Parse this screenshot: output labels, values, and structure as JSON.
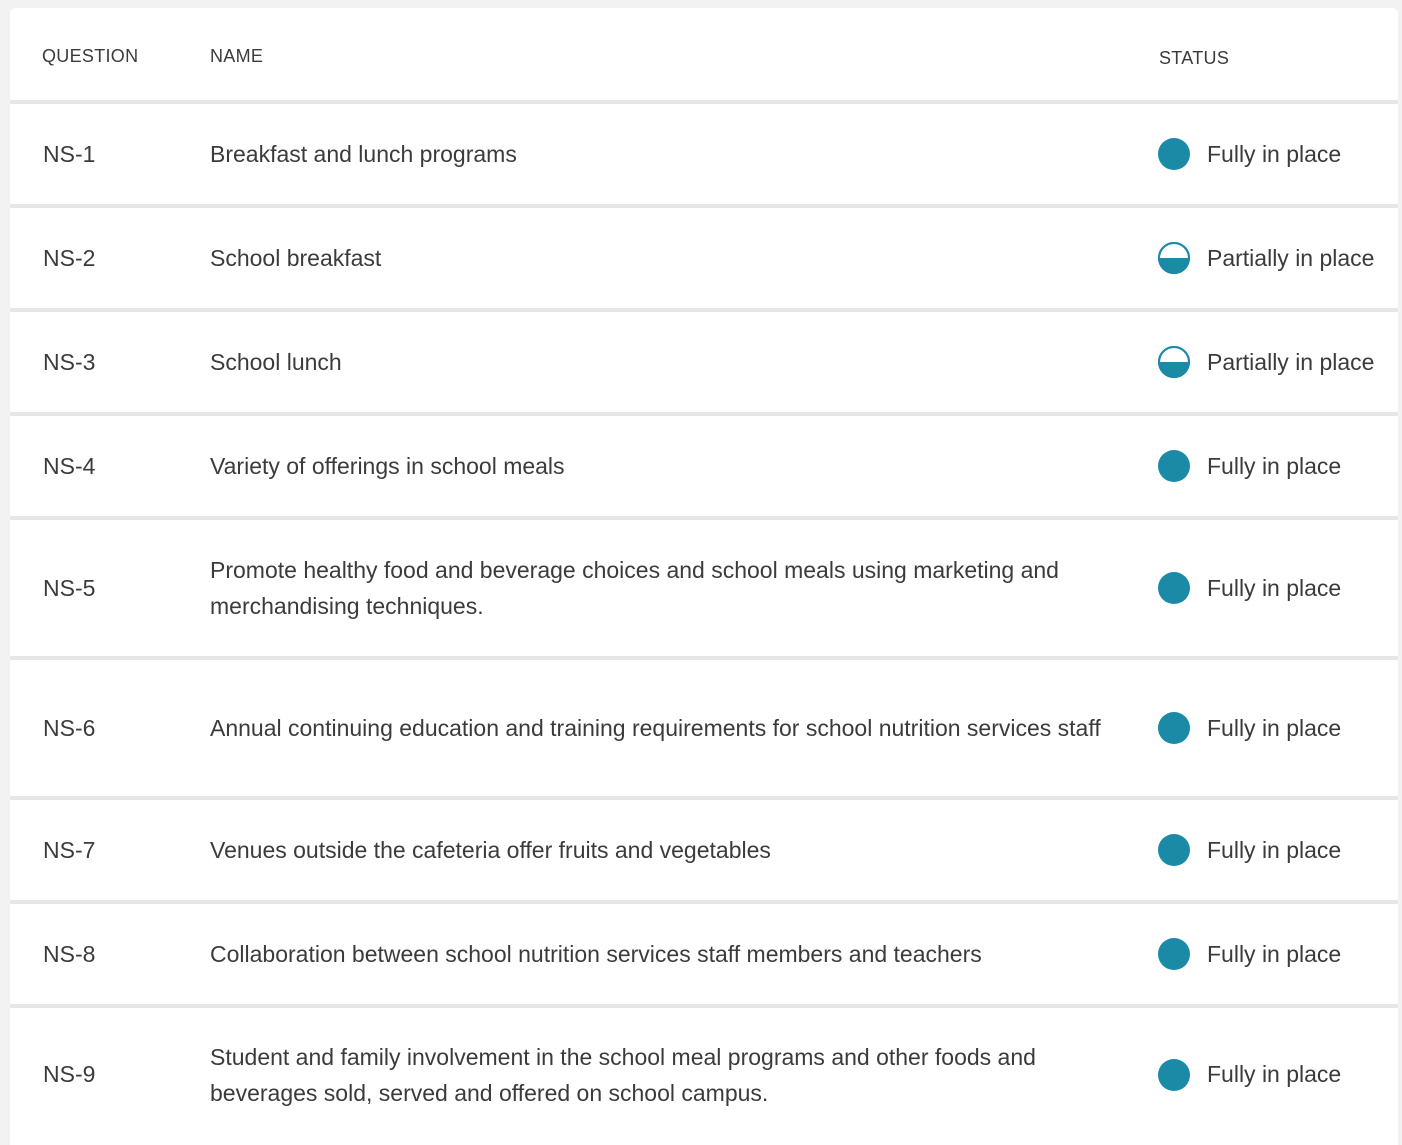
{
  "colors": {
    "accent": "#1b8aa6",
    "divider": "#e6e6e6",
    "text": "#3b3b3b"
  },
  "table": {
    "headers": {
      "question": "QUESTION",
      "name": "NAME",
      "status": "STATUS"
    },
    "rows": [
      {
        "question": "NS-1",
        "name": "Breakfast and lunch programs",
        "status": "Fully in place",
        "status_icon": "full-circle-icon"
      },
      {
        "question": "NS-2",
        "name": "School breakfast",
        "status": "Partially in place",
        "status_icon": "half-circle-icon"
      },
      {
        "question": "NS-3",
        "name": "School lunch",
        "status": "Partially in place",
        "status_icon": "half-circle-icon"
      },
      {
        "question": "NS-4",
        "name": "Variety of offerings in school meals",
        "status": "Fully in place",
        "status_icon": "full-circle-icon"
      },
      {
        "question": "NS-5",
        "name": "Promote healthy food and beverage choices and school meals using marketing and merchandising techniques.",
        "status": "Fully in place",
        "status_icon": "full-circle-icon"
      },
      {
        "question": "NS-6",
        "name": "Annual continuing education and training requirements for school nutrition services staff",
        "status": "Fully in place",
        "status_icon": "full-circle-icon"
      },
      {
        "question": "NS-7",
        "name": "Venues outside the cafeteria offer fruits and vegetables",
        "status": "Fully in place",
        "status_icon": "full-circle-icon"
      },
      {
        "question": "NS-8",
        "name": "Collaboration between school nutrition services staff members and teachers",
        "status": "Fully in place",
        "status_icon": "full-circle-icon"
      },
      {
        "question": "NS-9",
        "name": "Student and family involvement in the school meal programs and other foods and beverages sold, served and offered on school campus.",
        "status": "Fully in place",
        "status_icon": "full-circle-icon"
      }
    ]
  }
}
